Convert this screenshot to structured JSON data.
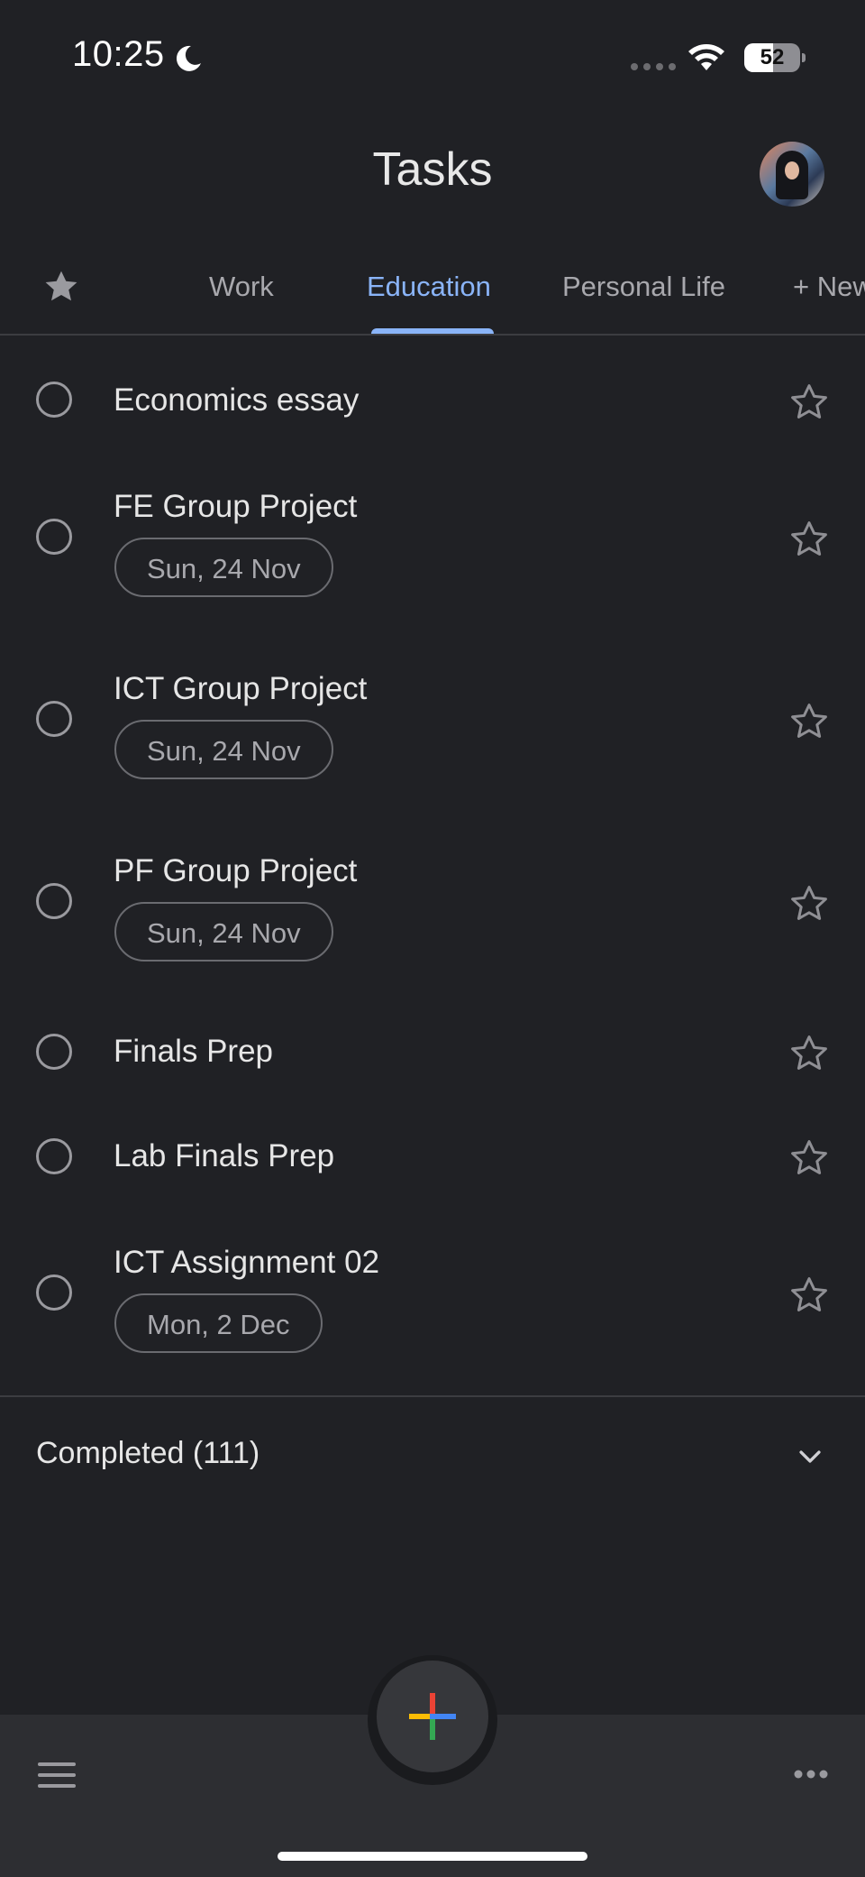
{
  "status_bar": {
    "time": "10:25",
    "battery": "52",
    "battery_level": 0.52
  },
  "header": {
    "title": "Tasks"
  },
  "tabs": [
    {
      "label": "Work"
    },
    {
      "label": "Education",
      "active": true
    },
    {
      "label": "Personal Life"
    },
    {
      "label": "+ New list"
    }
  ],
  "tasks": [
    {
      "title": "Economics essay",
      "date": ""
    },
    {
      "title": "FE Group Project",
      "date": "Sun, 24 Nov"
    },
    {
      "title": "ICT Group Project",
      "date": "Sun, 24 Nov"
    },
    {
      "title": "PF Group Project",
      "date": "Sun, 24 Nov"
    },
    {
      "title": "Finals Prep",
      "date": ""
    },
    {
      "title": "Lab Finals Prep",
      "date": ""
    },
    {
      "title": "ICT Assignment 02",
      "date": "Mon, 2 Dec"
    }
  ],
  "completed": {
    "label": "Completed (111)"
  },
  "colors": {
    "background": "#202125",
    "accent": "#8ab4f8",
    "bottom_bar": "#2d2e32"
  },
  "icons": [
    "moon-icon",
    "wifi-icon",
    "battery-icon",
    "star-icon",
    "chevron-down-icon",
    "menu-icon",
    "more-icon",
    "plus-icon"
  ]
}
